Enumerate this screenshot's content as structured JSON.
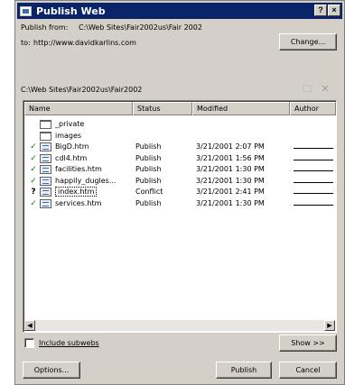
{
  "window": {
    "title": "Publish Web",
    "help_label": "?",
    "close_label": "×"
  },
  "publish": {
    "from_label": "Publish from:",
    "from_path": "C:\\Web Sites\\Fair2002us\\Fair 2002",
    "to_label": "to:",
    "to_url": "http://www.davidkarlins.com",
    "change_button": "Change..."
  },
  "current_folder": "C:\\Web Sites\\Fair2002us\\Fair2002",
  "toolbar": {
    "up_icon": "folder-up-icon",
    "delete_icon": "delete-x-icon"
  },
  "columns": {
    "name": "Name",
    "status": "Status",
    "modified": "Modified",
    "author": "Author"
  },
  "files": [
    {
      "mark": "",
      "icon": "folder",
      "name": "_private",
      "status": "",
      "modified": ""
    },
    {
      "mark": "",
      "icon": "folder",
      "name": "images",
      "status": "",
      "modified": ""
    },
    {
      "mark": "✓",
      "icon": "page",
      "name": "BigD.htm",
      "status": "Publish",
      "modified": "3/21/2001 2:07 PM"
    },
    {
      "mark": "✓",
      "icon": "page",
      "name": "cdl4.htm",
      "status": "Publish",
      "modified": "3/21/2001 1:56 PM"
    },
    {
      "mark": "✓",
      "icon": "page",
      "name": "facilities.htm",
      "status": "Publish",
      "modified": "3/21/2001 1:30 PM"
    },
    {
      "mark": "✓",
      "icon": "page",
      "name": "happily_dugles...",
      "status": "Publish",
      "modified": "3/21/2001 1:30 PM"
    },
    {
      "mark": "?",
      "icon": "page",
      "name": "index.htm",
      "status": "Conflict",
      "modified": "3/21/2001 2:41 PM"
    },
    {
      "mark": "✓",
      "icon": "page",
      "name": "services.htm",
      "status": "Publish",
      "modified": "3/21/2001 1:30 PM"
    }
  ],
  "include_subwebs_label": "Include subwebs",
  "include_subwebs_checked": false,
  "show_button": "Show >>",
  "options_button": "Options...",
  "publish_button": "Publish",
  "cancel_button": "Cancel"
}
